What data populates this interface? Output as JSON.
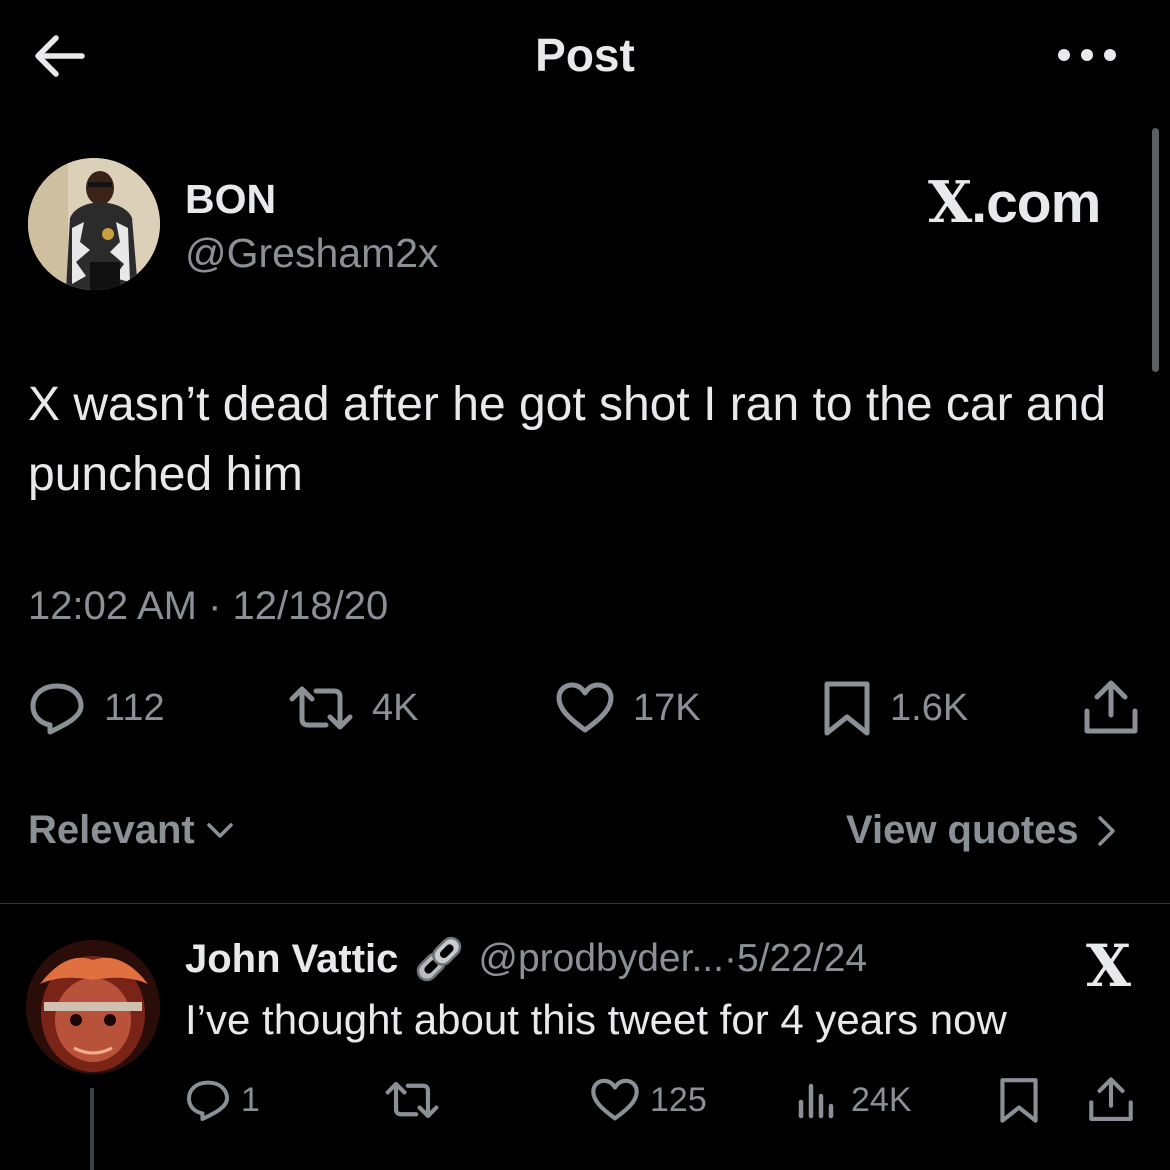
{
  "header": {
    "title": "Post",
    "back_icon": "arrow-left-icon",
    "more_icon": "more-dots-icon"
  },
  "post": {
    "author": {
      "display_name": "BON",
      "handle": "@Gresham2x"
    },
    "badge_x": "X",
    "badge_rest": ".com",
    "text": "X wasn’t dead after he got shot I ran to the car and punched him",
    "timestamp": "12:02 AM · 12/18/20",
    "stats": {
      "replies": "112",
      "reposts": "4K",
      "likes": "17K",
      "bookmarks": "1.6K"
    }
  },
  "sort": {
    "label": "Relevant",
    "view_quotes": "View quotes"
  },
  "reply": {
    "display_name": "John Vattic",
    "handle": "@prodbyder...",
    "separator": " · ",
    "date": "5/22/24",
    "badge_x": "X",
    "text": "I’ve thought about this tweet for 4 years now",
    "stats": {
      "replies": "1",
      "likes": "125",
      "views": "24K"
    }
  },
  "colors": {
    "background": "#000000",
    "primary_text": "#e7e9ea",
    "secondary_text": "#8b9096",
    "divider": "#2f3336"
  }
}
